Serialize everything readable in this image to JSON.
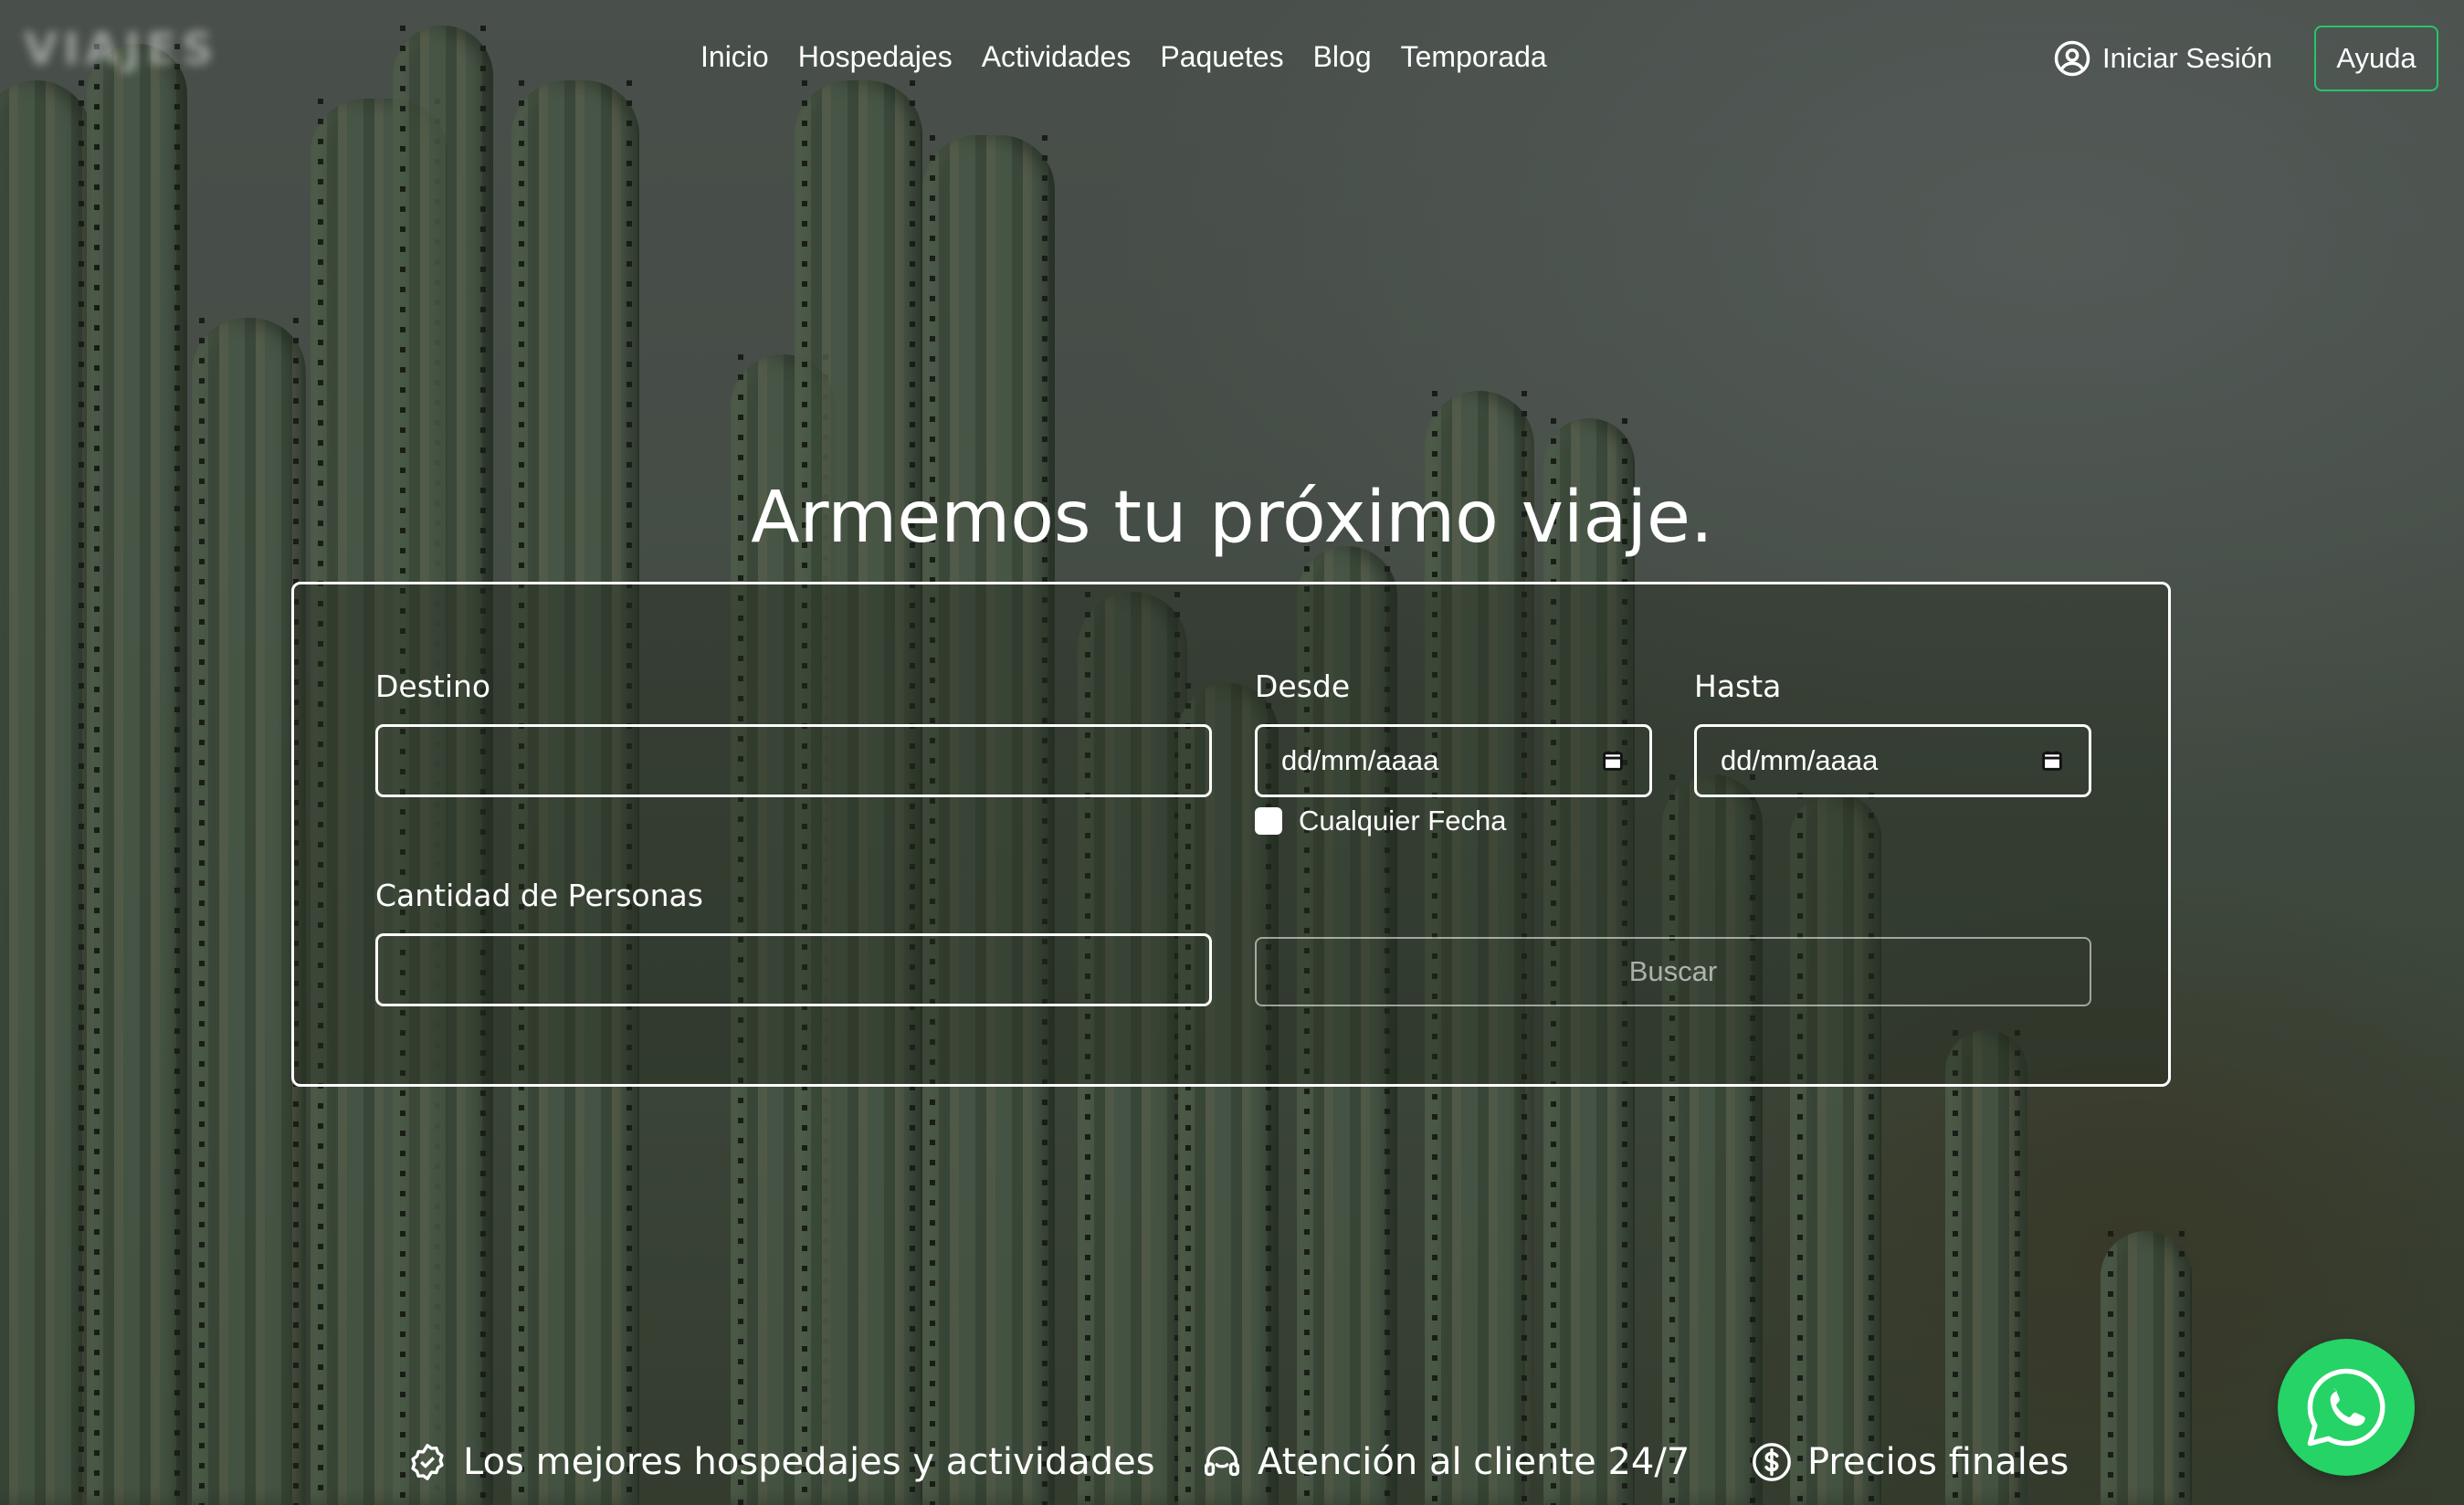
{
  "header": {
    "logo_text": "VIAJES",
    "nav": [
      "Inicio",
      "Hospedajes",
      "Actividades",
      "Paquetes",
      "Blog",
      "Temporada"
    ],
    "login_label": "Iniciar Sesión",
    "login_icon": "user-circle-icon",
    "help_label": "Ayuda"
  },
  "hero": {
    "title": "Armemos tu próximo viaje."
  },
  "search_form": {
    "destino_label": "Destino",
    "destino_value": "",
    "desde_label": "Desde",
    "desde_placeholder": "dd/mm/aaaa",
    "hasta_label": "Hasta",
    "hasta_placeholder": "dd/mm/aaaa",
    "any_date_label": "Cualquier Fecha",
    "any_date_checked": false,
    "personas_label": "Cantidad de Personas",
    "personas_value": "",
    "search_button": "Buscar"
  },
  "features": [
    {
      "icon": "badge-check-icon",
      "text": "Los mejores hospedajes y actividades"
    },
    {
      "icon": "headset-icon",
      "text": "Atención al cliente 24/7"
    },
    {
      "icon": "dollar-circle-icon",
      "text": "Precios finales"
    }
  ],
  "colors": {
    "accent_green": "#26c46a",
    "whatsapp_green": "#25d366"
  },
  "whatsapp_icon": "whatsapp-icon"
}
